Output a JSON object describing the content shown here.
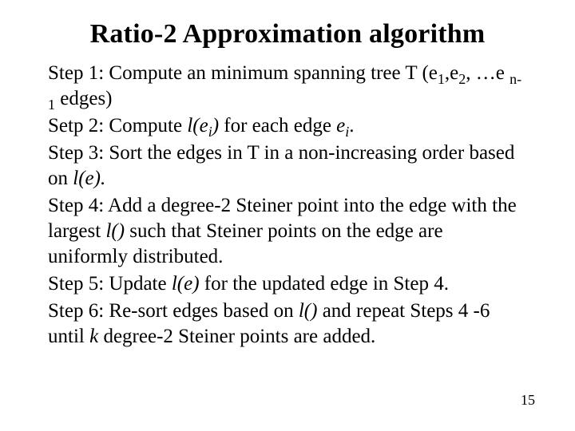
{
  "title": "Ratio-2 Approximation algorithm",
  "steps": {
    "s1a": "Step 1: Compute an minimum spanning tree T (e",
    "s1_sub1": "1",
    "s1b": ",e",
    "s1_sub2": "2",
    "s1c": ", …e ",
    "s1_sub3": "n-1",
    "s1d": " edges)",
    "s2a": "Setp 2: Compute ",
    "s2_lei": "l(e",
    "s2_sub_i": "i",
    "s2_close": ")",
    "s2b": " for each edge ",
    "s2_e": "e",
    "s2_sub_i2": "i",
    "s2_end": ".",
    "s3": "Step 3:  Sort the edges in T in a non-increasing order based on ",
    "s3_le": "l(e).",
    "s4a": "Step 4: Add a degree-2 Steiner point into the  edge with the largest ",
    "s4_l": "l()",
    "s4b": " such that Steiner points on the edge are uniformly distributed.",
    "s5a": "Step 5: Update ",
    "s5_le": "l(e)",
    "s5b": " for the updated edge in Step 4.",
    "s6a": "Step 6: Re-sort edges based on ",
    "s6_l": "l()",
    "s6b": " and repeat Steps 4 -6 until ",
    "s6_k": "k",
    "s6c": " degree-2 Steiner points are added."
  },
  "pagenum": "15"
}
